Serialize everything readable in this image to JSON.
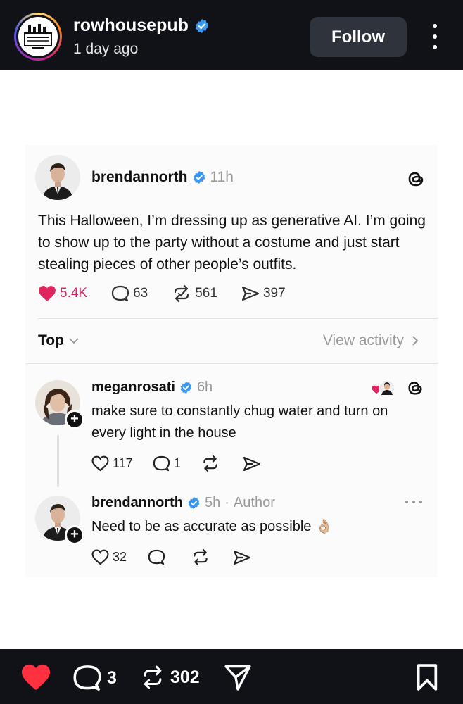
{
  "instagram_header": {
    "username": "rowhousepub",
    "time": "1 day ago",
    "follow_label": "Follow",
    "avatar_icon": "rowhouse-logo-icon"
  },
  "threads_post": {
    "author": "brendannorth",
    "time": "11h",
    "text": "This Halloween, I’m dressing up as generative AI. I’m going to show up to the party without a costume and just start stealing pieces of other people’s outfits.",
    "likes": "5.4K",
    "replies": "63",
    "reposts": "561",
    "shares": "397",
    "sort_label": "Top",
    "view_activity_label": "View activity"
  },
  "replies": [
    {
      "author": "meganrosati",
      "time": "6h",
      "text": "make sure to constantly chug water and turn on every light in the house",
      "likes": "117",
      "replies": "1"
    },
    {
      "author": "brendannorth",
      "time": "5h",
      "author_tag": "Author",
      "text": "Need to be as accurate as possible",
      "emoji": "👌🏼",
      "likes": "32"
    }
  ],
  "instagram_footer": {
    "comments": "3",
    "reposts": "302"
  },
  "colors": {
    "bar_background": "#101218",
    "verified_blue": "#3897f0",
    "like_red": "#e0245e",
    "ig_heart_red": "#ff3040"
  }
}
